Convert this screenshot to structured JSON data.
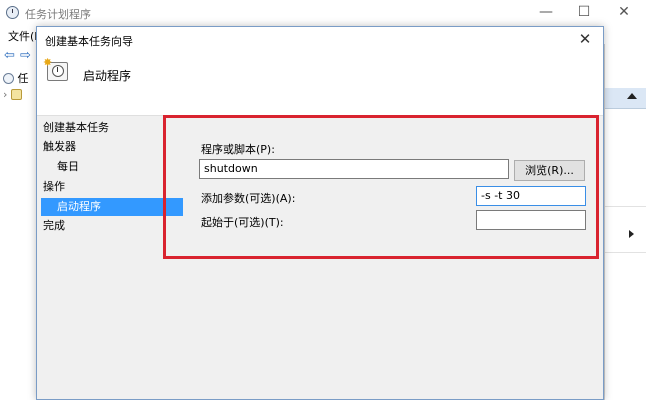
{
  "main_window": {
    "title": "任务计划程序",
    "menu_file": "文件(F",
    "tree_item_label": "任",
    "win_minimize": "—",
    "win_maximize": "☐",
    "win_close": "✕"
  },
  "dialog": {
    "title": "创建基本任务向导",
    "close_glyph": "✕",
    "header_title": "启动程序",
    "nav": [
      "创建基本任务",
      "触发器",
      "每日",
      "操作",
      "启动程序",
      "完成"
    ],
    "program_label": "程序或脚本(P):",
    "program_value": "shutdown",
    "browse_button": "浏览(R)...",
    "args_label": "添加参数(可选)(A):",
    "args_value": "-s -t 30",
    "startin_label": "起始于(可选)(T):",
    "startin_value": ""
  },
  "colors": {
    "highlight": "#d9232f",
    "selection": "#3399ff"
  }
}
